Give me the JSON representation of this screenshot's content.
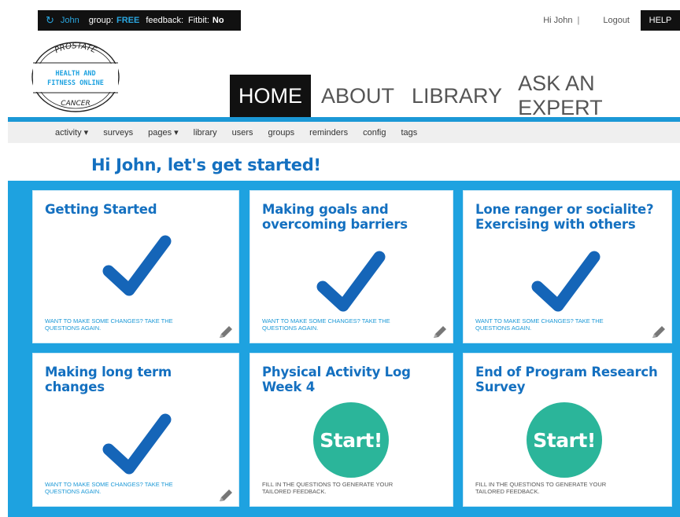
{
  "statusbar": {
    "user": "John",
    "group_label": "group:",
    "group_value": "FREE",
    "feedback_label": "feedback:",
    "fitbit_label": "Fitbit:",
    "fitbit_value": "No"
  },
  "topright": {
    "greeting": "Hi John",
    "separator": "|",
    "logout": "Logout",
    "help": "HELP"
  },
  "logo": {
    "top_text": "PROSTATE",
    "line1": "HEALTH AND",
    "line2": "FITNESS ONLINE",
    "bottom_text": "CANCER"
  },
  "mainnav": [
    "HOME",
    "ABOUT",
    "LIBRARY",
    "ASK AN EXPERT"
  ],
  "subnav": [
    "activity ▾",
    "surveys",
    "pages ▾",
    "library",
    "users",
    "groups",
    "reminders",
    "config",
    "tags"
  ],
  "greeting": "Hi John, let's get started!",
  "cards": [
    {
      "title": "Getting Started",
      "note": "WANT TO MAKE SOME CHANGES? TAKE THE QUESTIONS AGAIN.",
      "status": "completed"
    },
    {
      "title": "Making goals and overcoming barriers",
      "note": "WANT TO MAKE SOME CHANGES? TAKE THE QUESTIONS AGAIN.",
      "status": "completed"
    },
    {
      "title": "Lone ranger or socialite? Exercising with others",
      "note": "WANT TO MAKE SOME CHANGES? TAKE THE QUESTIONS AGAIN.",
      "status": "completed"
    },
    {
      "title": "Making long term changes",
      "note": "WANT TO MAKE SOME CHANGES? TAKE THE QUESTIONS AGAIN.",
      "status": "completed"
    },
    {
      "title": "Physical Activity Log Week 4",
      "note": "FILL IN THE QUESTIONS TO GENERATE YOUR TAILORED FEEDBACK.",
      "status": "start",
      "start_label": "Start!"
    },
    {
      "title": "End of Program Research Survey",
      "note": "FILL IN THE QUESTIONS TO GENERATE YOUR TAILORED FEEDBACK.",
      "status": "start",
      "start_label": "Start!"
    }
  ],
  "colors": {
    "brand_blue": "#1470c0",
    "bar_blue": "#1ea2e0",
    "check_blue": "#1565b8",
    "start_green": "#2bb59a"
  },
  "icons": {
    "sync": "sync-icon",
    "check": "checkmark-icon",
    "edit": "pencil-icon"
  }
}
